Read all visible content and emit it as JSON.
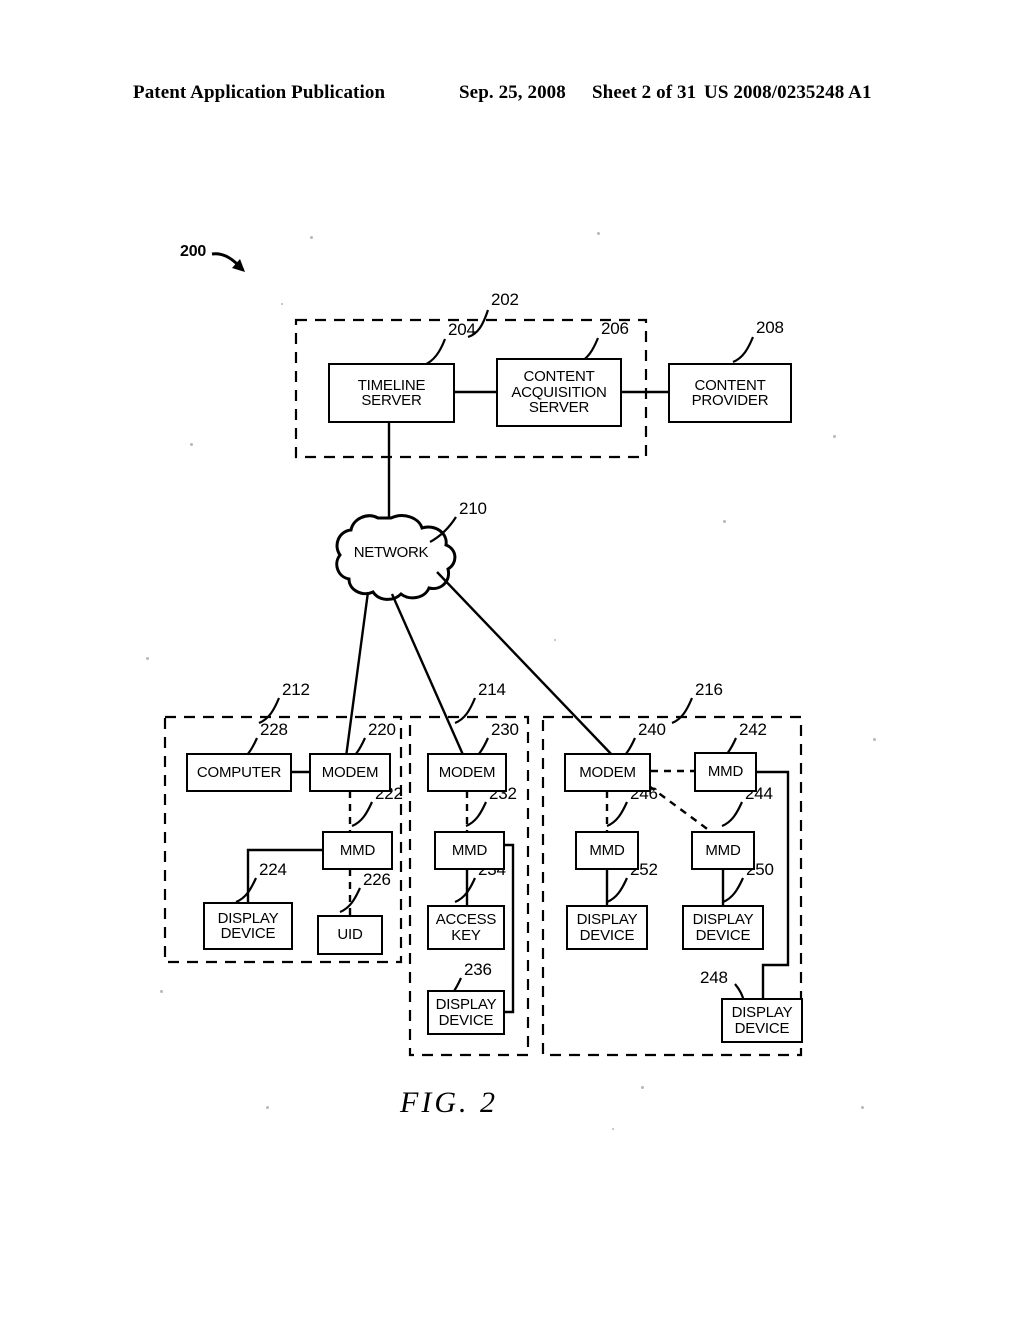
{
  "header": {
    "publication": "Patent Application Publication",
    "date": "Sep. 25, 2008",
    "sheet": "Sheet 2 of 31",
    "patent_number": "US 2008/0235248 A1"
  },
  "figure": {
    "caption": "FIG. 2",
    "system_ref": "200"
  },
  "cloud": {
    "label": "NETWORK",
    "ref": "210"
  },
  "groups": [
    {
      "ref": "202",
      "name": "headend-group"
    },
    {
      "ref": "212",
      "name": "subscriber-group-1"
    },
    {
      "ref": "214",
      "name": "subscriber-group-2"
    },
    {
      "ref": "216",
      "name": "subscriber-group-3"
    }
  ],
  "nodes": [
    {
      "ref": "204",
      "label": "TIMELINE\nSERVER",
      "name": "timeline-server"
    },
    {
      "ref": "206",
      "label": "CONTENT\nACQUISITION\nSERVER",
      "name": "content-acquisition-server"
    },
    {
      "ref": "208",
      "label": "CONTENT\nPROVIDER",
      "name": "content-provider"
    },
    {
      "ref": "228",
      "label": "COMPUTER",
      "name": "computer-228"
    },
    {
      "ref": "220",
      "label": "MODEM",
      "name": "modem-220"
    },
    {
      "ref": "222",
      "label": "MMD",
      "name": "mmd-222"
    },
    {
      "ref": "224",
      "label": "DISPLAY\nDEVICE",
      "name": "display-device-224"
    },
    {
      "ref": "226",
      "label": "UID",
      "name": "uid-226"
    },
    {
      "ref": "230",
      "label": "MODEM",
      "name": "modem-230"
    },
    {
      "ref": "232",
      "label": "MMD",
      "name": "mmd-232"
    },
    {
      "ref": "234",
      "label": "ACCESS\nKEY",
      "name": "access-key-234"
    },
    {
      "ref": "236",
      "label": "DISPLAY\nDEVICE",
      "name": "display-device-236"
    },
    {
      "ref": "240",
      "label": "MODEM",
      "name": "modem-240"
    },
    {
      "ref": "242",
      "label": "MMD",
      "name": "mmd-242"
    },
    {
      "ref": "244",
      "label": "MMD",
      "name": "mmd-244"
    },
    {
      "ref": "246",
      "label": "MMD",
      "name": "mmd-246"
    },
    {
      "ref": "248",
      "label": "DISPLAY\nDEVICE",
      "name": "display-device-248"
    },
    {
      "ref": "250",
      "label": "DISPLAY\nDEVICE",
      "name": "display-device-250"
    },
    {
      "ref": "252",
      "label": "DISPLAY\nDEVICE",
      "name": "display-device-252"
    }
  ],
  "colors": {
    "ink": "#000000",
    "paper": "#ffffff"
  }
}
